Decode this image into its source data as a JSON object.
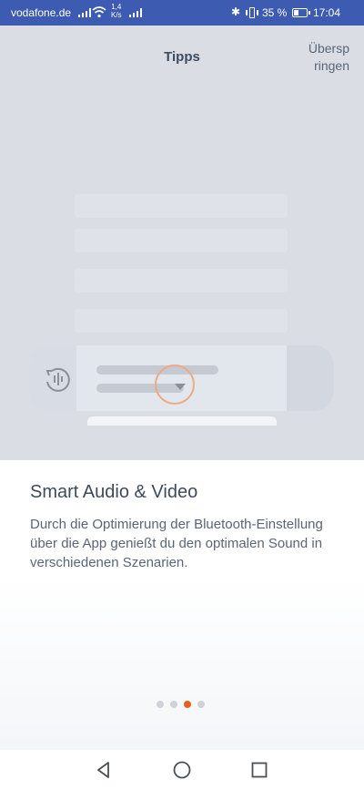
{
  "status_bar": {
    "carrier": "vodafone.de",
    "speed_value": "1,4",
    "speed_unit": "K/s",
    "battery_percent": "35 %",
    "battery_level": 0.35,
    "time": "17:04",
    "icons": [
      "signal-icon",
      "wifi-icon",
      "signal-icon",
      "bluetooth-icon",
      "vibrate-icon",
      "battery-icon"
    ]
  },
  "header": {
    "title": "Tipps",
    "skip_line1": "Übersp",
    "skip_line2": "ringen"
  },
  "tip": {
    "heading": "Smart Audio & Video",
    "description": "Durch die Optimierung der Bluetooth-Einstellung über die App genießt du den optimalen Sound in verschiedenen Szenarien."
  },
  "pagination": {
    "total": 4,
    "active_index": 2
  },
  "colors": {
    "accent": "#e8611a",
    "status_bar": "#3d5bb0",
    "illustration_bg": "#dadde3"
  },
  "nav_bar": {
    "icons": [
      "back-icon",
      "home-icon",
      "recents-icon"
    ]
  }
}
